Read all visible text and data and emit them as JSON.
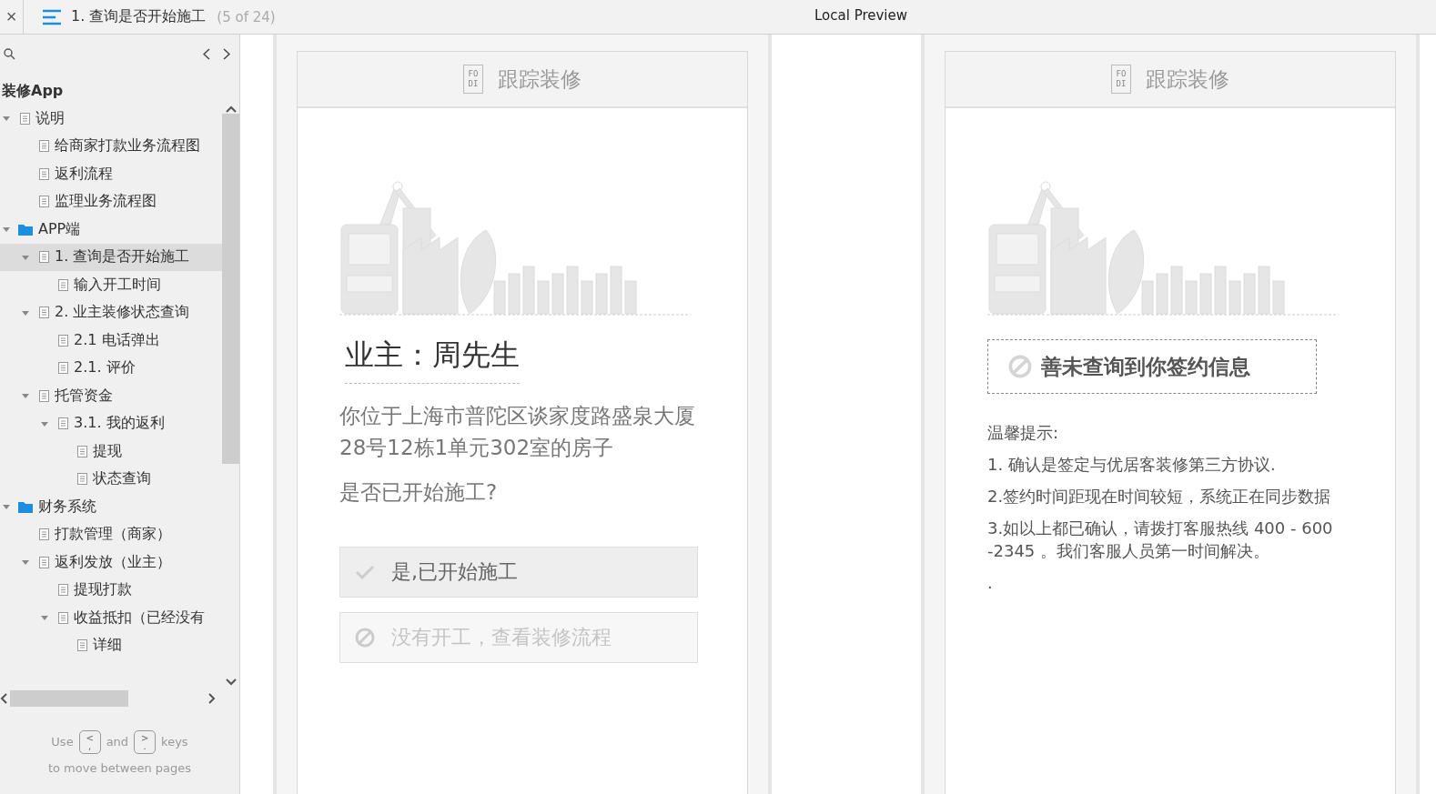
{
  "topbar": {
    "close": "×",
    "page_title": "1. 查询是否开始施工",
    "page_count": "(5 of 24)",
    "center_title": "Local Preview"
  },
  "sidebar": {
    "project": "装修App",
    "tree": [
      {
        "label": "说明",
        "kind": "page",
        "expanded": true,
        "selected": false,
        "children": [
          {
            "label": "给商家打款业务流程图",
            "kind": "page",
            "selected": false
          },
          {
            "label": "返利流程",
            "kind": "page",
            "selected": false
          },
          {
            "label": "监理业务流程图",
            "kind": "page",
            "selected": false
          }
        ]
      },
      {
        "label": "APP端",
        "kind": "folder",
        "expanded": true,
        "selected": false,
        "children": [
          {
            "label": "1. 查询是否开始施工",
            "kind": "page",
            "expanded": true,
            "selected": true,
            "children": [
              {
                "label": "输入开工时间",
                "kind": "page",
                "selected": false
              }
            ]
          },
          {
            "label": "2. 业主装修状态查询",
            "kind": "page",
            "expanded": true,
            "selected": false,
            "children": [
              {
                "label": "2.1 电话弹出",
                "kind": "page",
                "selected": false
              },
              {
                "label": "2.1. 评价",
                "kind": "page",
                "selected": false
              }
            ]
          },
          {
            "label": "托管资金",
            "kind": "page",
            "expanded": true,
            "selected": false,
            "children": [
              {
                "label": "3.1. 我的返利",
                "kind": "page",
                "expanded": true,
                "selected": false,
                "children": [
                  {
                    "label": "提现",
                    "kind": "page",
                    "selected": false
                  },
                  {
                    "label": "状态查询",
                    "kind": "page",
                    "selected": false
                  }
                ]
              }
            ]
          }
        ]
      },
      {
        "label": "财务系统",
        "kind": "folder",
        "expanded": true,
        "selected": false,
        "children": [
          {
            "label": "打款管理（商家）",
            "kind": "page",
            "selected": false
          },
          {
            "label": "返利发放（业主）",
            "kind": "page",
            "expanded": true,
            "selected": false,
            "children": [
              {
                "label": "提现打款",
                "kind": "page",
                "selected": false
              },
              {
                "label": "收益抵扣（已经没有",
                "kind": "page",
                "expanded": true,
                "selected": false,
                "children": [
                  {
                    "label": "详细",
                    "kind": "page",
                    "selected": false
                  }
                ]
              }
            ]
          }
        ]
      }
    ],
    "hint": {
      "use": "Use",
      "key_prev": {
        "top": "<",
        "bottom": ","
      },
      "and": "and",
      "key_next": {
        "top": ">",
        "bottom": "."
      },
      "keys": "keys",
      "line2": "to move between pages"
    }
  },
  "screens": [
    {
      "kind": "start",
      "header": "跟踪装修",
      "logo": [
        "FO",
        "DI"
      ],
      "owner": "业主：周先生",
      "address": "你位于上海市普陀区谈家度路盛泉大厦28号12栋1单元302室的房子",
      "question": "是否已开始施工?",
      "buttons": [
        {
          "label": "是,已开始施工",
          "kind": "confirm",
          "disabled": false
        },
        {
          "label": "没有开工，查看装修流程",
          "kind": "decline",
          "disabled": true
        }
      ]
    },
    {
      "kind": "notice",
      "header": "跟踪装修",
      "logo": [
        "FO",
        "DI"
      ],
      "notice": "善未查询到你签约信息",
      "tips_title": "温馨提示:",
      "tips": [
        "1. 确认是签定与优居客装修第三方协议.",
        "2.签约时间距现在时间较短，系统正在同步数据",
        "3.如以上都已确认，请拨打客服热线  400 - 600 -2345 。我们客服人员第一时间解决。",
        "."
      ]
    }
  ]
}
